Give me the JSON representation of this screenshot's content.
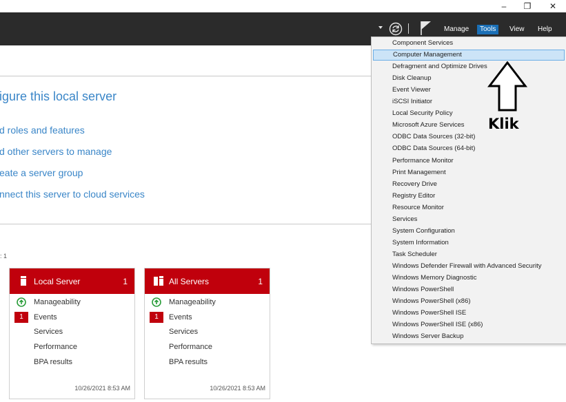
{
  "window": {
    "minimize_glyph": "–",
    "maximize_glyph": "❐",
    "close_glyph": "✕"
  },
  "header": {
    "menu": [
      "Manage",
      "Tools",
      "View",
      "Help"
    ],
    "active_menu": "Tools",
    "icons": [
      "dropdown-caret-icon",
      "refresh-icon",
      "notification-flag-icon"
    ]
  },
  "quick_start": {
    "title": "igure this local server",
    "links": [
      "d roles and features",
      "d other servers to manage",
      "eate a server group",
      "nnect this server to cloud services"
    ],
    "tiles_label": ": 1"
  },
  "tiles": [
    {
      "title": "Local Server",
      "count": "1",
      "icon": "server-icon",
      "rows": [
        "Manageability",
        "Events",
        "Services",
        "Performance",
        "BPA results"
      ],
      "events_badge": "1",
      "timestamp": "10/26/2021 8:53 AM"
    },
    {
      "title": "All Servers",
      "count": "1",
      "icon": "servers-icon",
      "rows": [
        "Manageability",
        "Events",
        "Services",
        "Performance",
        "BPA results"
      ],
      "events_badge": "1",
      "timestamp": "10/26/2021 8:53 AM"
    }
  ],
  "tools_menu": {
    "items": [
      "Component Services",
      "Computer Management",
      "Defragment and Optimize Drives",
      "Disk Cleanup",
      "Event Viewer",
      "iSCSI Initiator",
      "Local Security Policy",
      "Microsoft Azure Services",
      "ODBC Data Sources (32-bit)",
      "ODBC Data Sources (64-bit)",
      "Performance Monitor",
      "Print Management",
      "Recovery Drive",
      "Registry Editor",
      "Resource Monitor",
      "Services",
      "System Configuration",
      "System Information",
      "Task Scheduler",
      "Windows Defender Firewall with Advanced Security",
      "Windows Memory Diagnostic",
      "Windows PowerShell",
      "Windows PowerShell (x86)",
      "Windows PowerShell ISE",
      "Windows PowerShell ISE (x86)",
      "Windows Server Backup"
    ],
    "selected": "Computer Management"
  },
  "annotation": {
    "label": "Klik",
    "icon": "up-arrow-icon"
  },
  "colors": {
    "header_bg": "#2b2b2b",
    "accent_blue": "#1a6fb6",
    "link_blue": "#3a86c8",
    "tile_red": "#c0000c",
    "ok_green": "#2a9d3a",
    "menu_bg": "#f2f2f2",
    "selected_bg": "#cce4f7"
  }
}
